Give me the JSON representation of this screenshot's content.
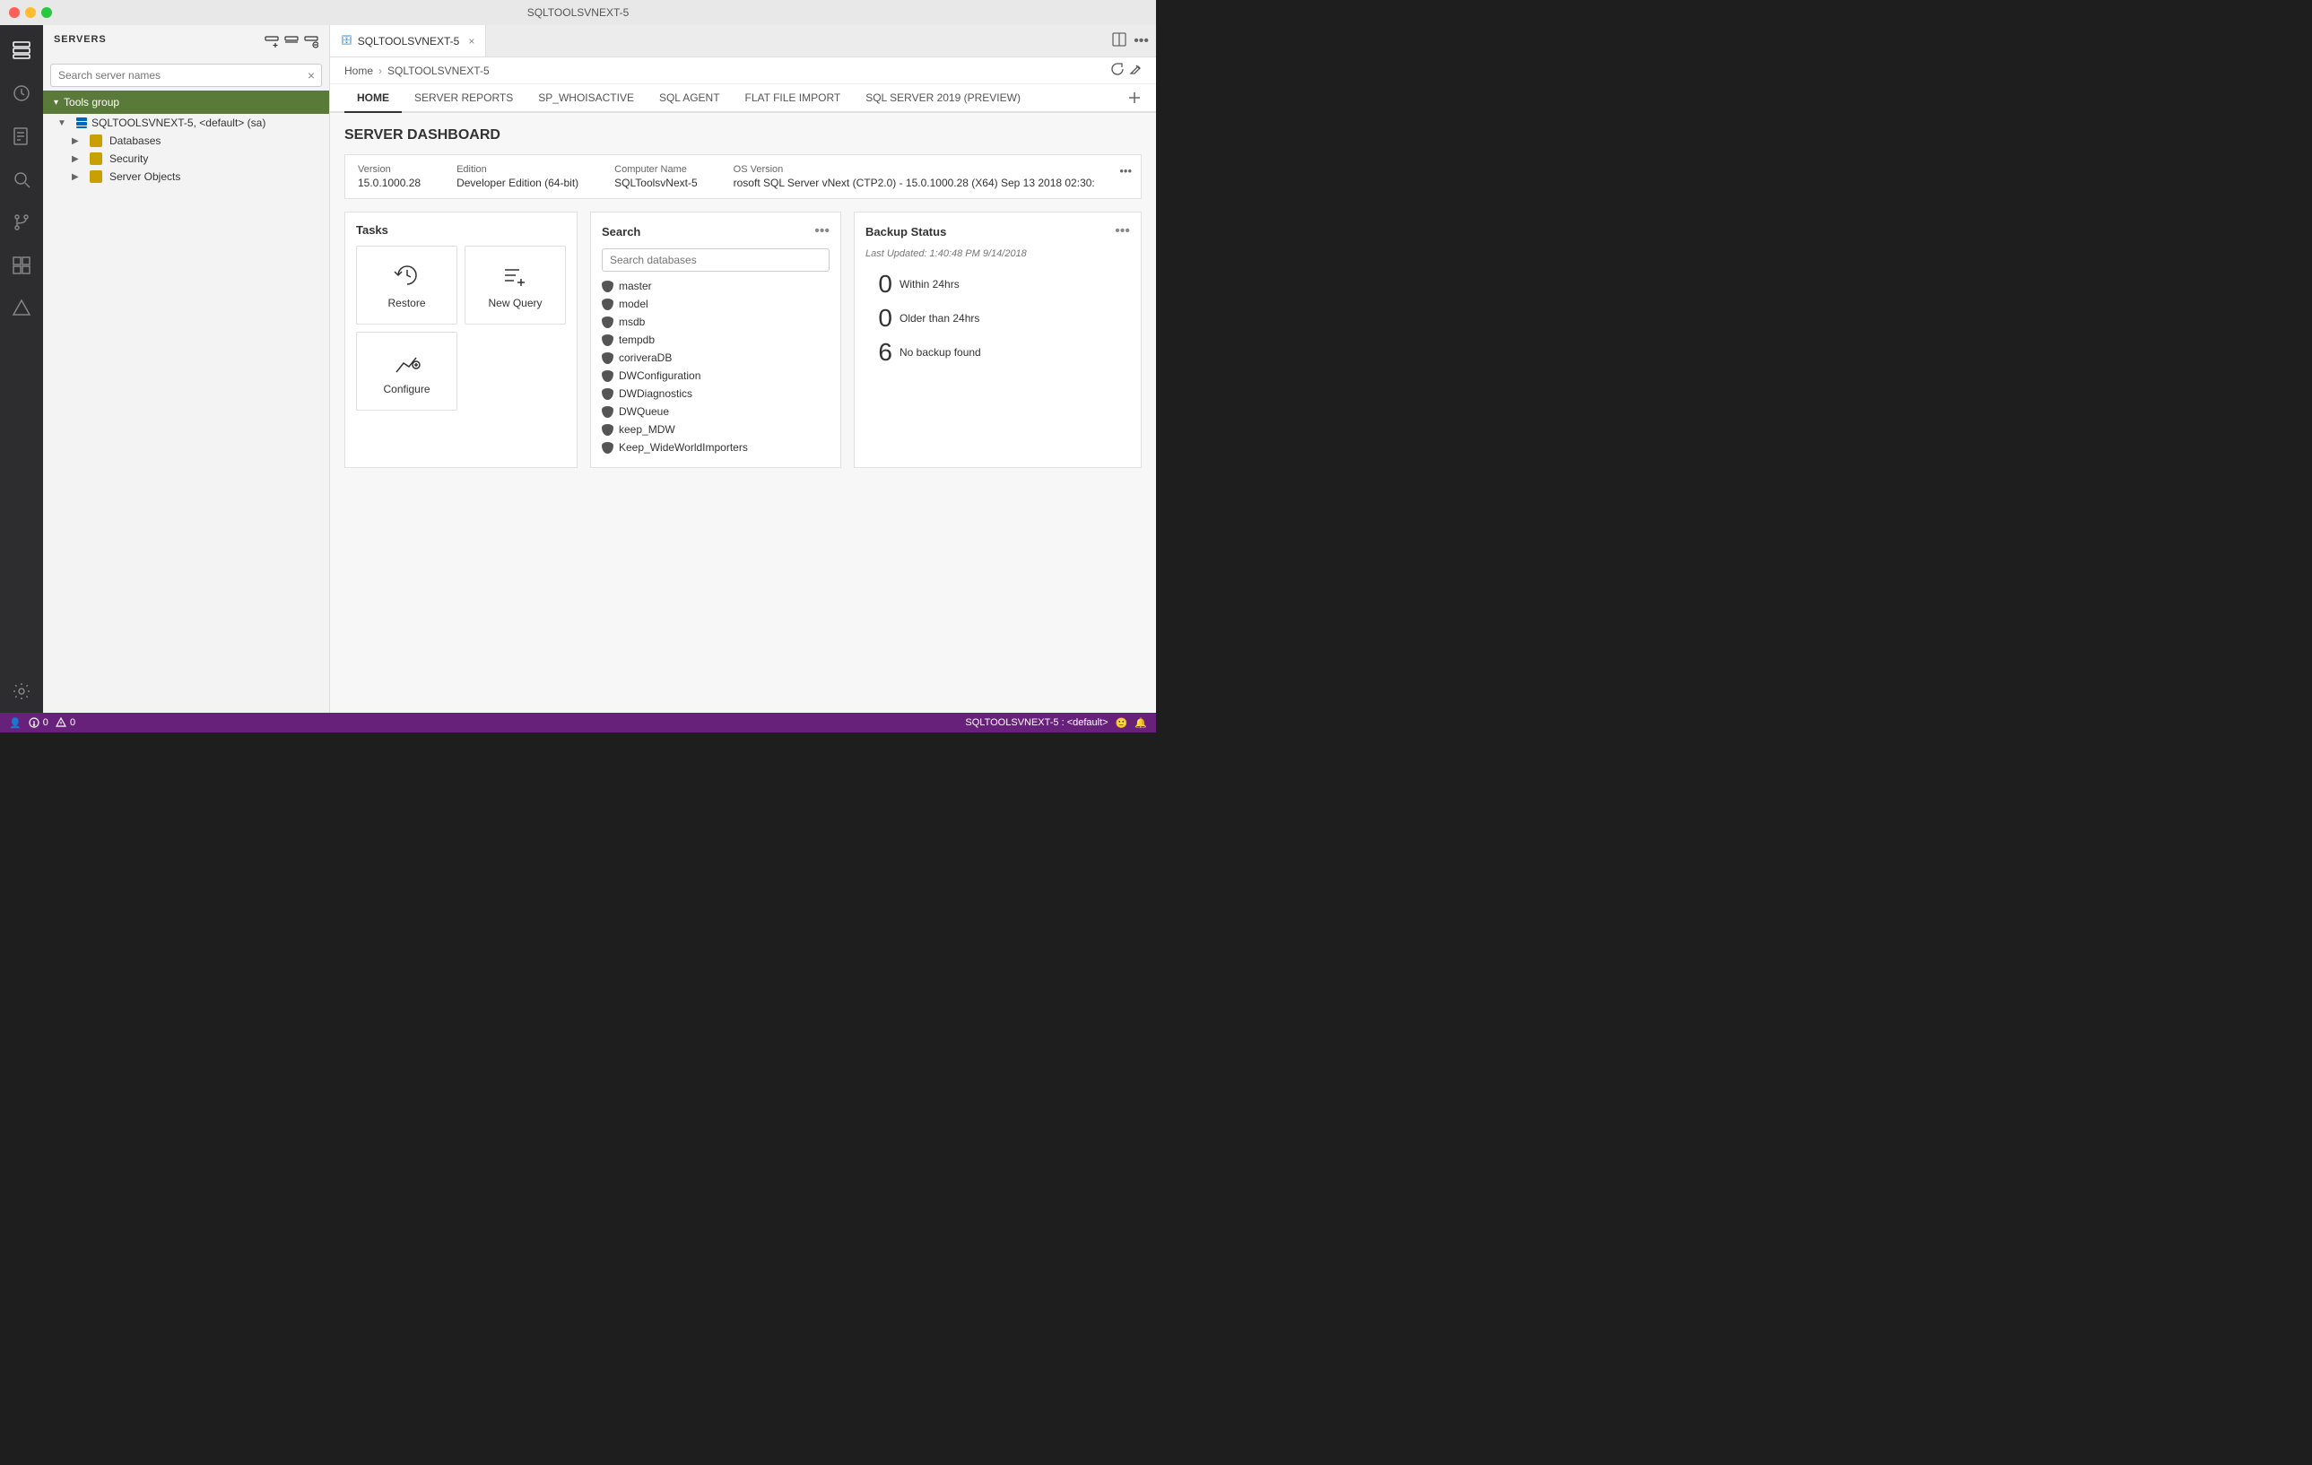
{
  "titlebar": {
    "title": "SQLTOOLSVNEXT-5"
  },
  "sidebar": {
    "header": "SERVERS",
    "search_placeholder": "Search server names",
    "tools_group_label": "Tools group",
    "tree": {
      "server": "SQLTOOLSVNEXT-5, <default> (sa)",
      "databases": "Databases",
      "security": "Security",
      "server_objects": "Server Objects"
    }
  },
  "tab": {
    "label": "SQLTOOLSVNEXT-5",
    "close": "×"
  },
  "breadcrumb": {
    "home": "Home",
    "server": "SQLTOOLSVNEXT-5"
  },
  "content_tabs": [
    {
      "id": "home",
      "label": "HOME",
      "active": true
    },
    {
      "id": "server-reports",
      "label": "SERVER REPORTS",
      "active": false
    },
    {
      "id": "sp-whoisactive",
      "label": "SP_WHOISACTIVE",
      "active": false
    },
    {
      "id": "sql-agent",
      "label": "SQL AGENT",
      "active": false
    },
    {
      "id": "flat-file-import",
      "label": "FLAT FILE IMPORT",
      "active": false
    },
    {
      "id": "sql-server-2019",
      "label": "SQL SERVER 2019 (PREVIEW)",
      "active": false
    }
  ],
  "dashboard": {
    "title": "SERVER DASHBOARD",
    "server_info": {
      "version_label": "Version",
      "version_value": "15.0.1000.28",
      "edition_label": "Edition",
      "edition_value": "Developer Edition (64-bit)",
      "computer_label": "Computer Name",
      "computer_value": "SQLToolsvNext-5",
      "os_label": "OS Version",
      "os_value": "rosoft SQL Server vNext (CTP2.0) - 15.0.1000.28 (X64) Sep 13 2018 02:30:"
    },
    "tasks": {
      "title": "Tasks",
      "items": [
        {
          "id": "restore",
          "label": "Restore",
          "icon": "restore"
        },
        {
          "id": "new-query",
          "label": "New Query",
          "icon": "new-query"
        },
        {
          "id": "configure",
          "label": "Configure",
          "icon": "configure"
        }
      ]
    },
    "search": {
      "title": "Search",
      "placeholder": "Search databases",
      "databases": [
        "master",
        "model",
        "msdb",
        "tempdb",
        "coriveraDB",
        "DWConfiguration",
        "DWDiagnostics",
        "DWQueue",
        "keep_MDW",
        "Keep_WideWorldImporters"
      ]
    },
    "backup": {
      "title": "Backup Status",
      "last_updated": "Last Updated: 1:40:48 PM 9/14/2018",
      "stats": [
        {
          "count": "0",
          "label": "Within 24hrs"
        },
        {
          "count": "0",
          "label": "Older than 24hrs"
        },
        {
          "count": "6",
          "label": "No backup found"
        }
      ]
    }
  },
  "status_bar": {
    "left": {
      "user_icon": "👤",
      "errors": "0",
      "warnings": "0"
    },
    "right": {
      "connection": "SQLTOOLSVNEXT-5 : <default>",
      "bell_icon": "🔔",
      "smiley_icon": "🙂"
    }
  },
  "activity_icons": [
    {
      "id": "servers",
      "icon": "⊞",
      "active": true
    },
    {
      "id": "history",
      "icon": "🕐",
      "active": false
    },
    {
      "id": "query",
      "icon": "📄",
      "active": false
    },
    {
      "id": "search",
      "icon": "🔍",
      "active": false
    },
    {
      "id": "git",
      "icon": "⑂",
      "active": false
    },
    {
      "id": "extensions",
      "icon": "⊟",
      "active": false
    },
    {
      "id": "profiler",
      "icon": "△",
      "active": false
    },
    {
      "id": "settings-bottom",
      "icon": "⚙",
      "active": false
    }
  ]
}
